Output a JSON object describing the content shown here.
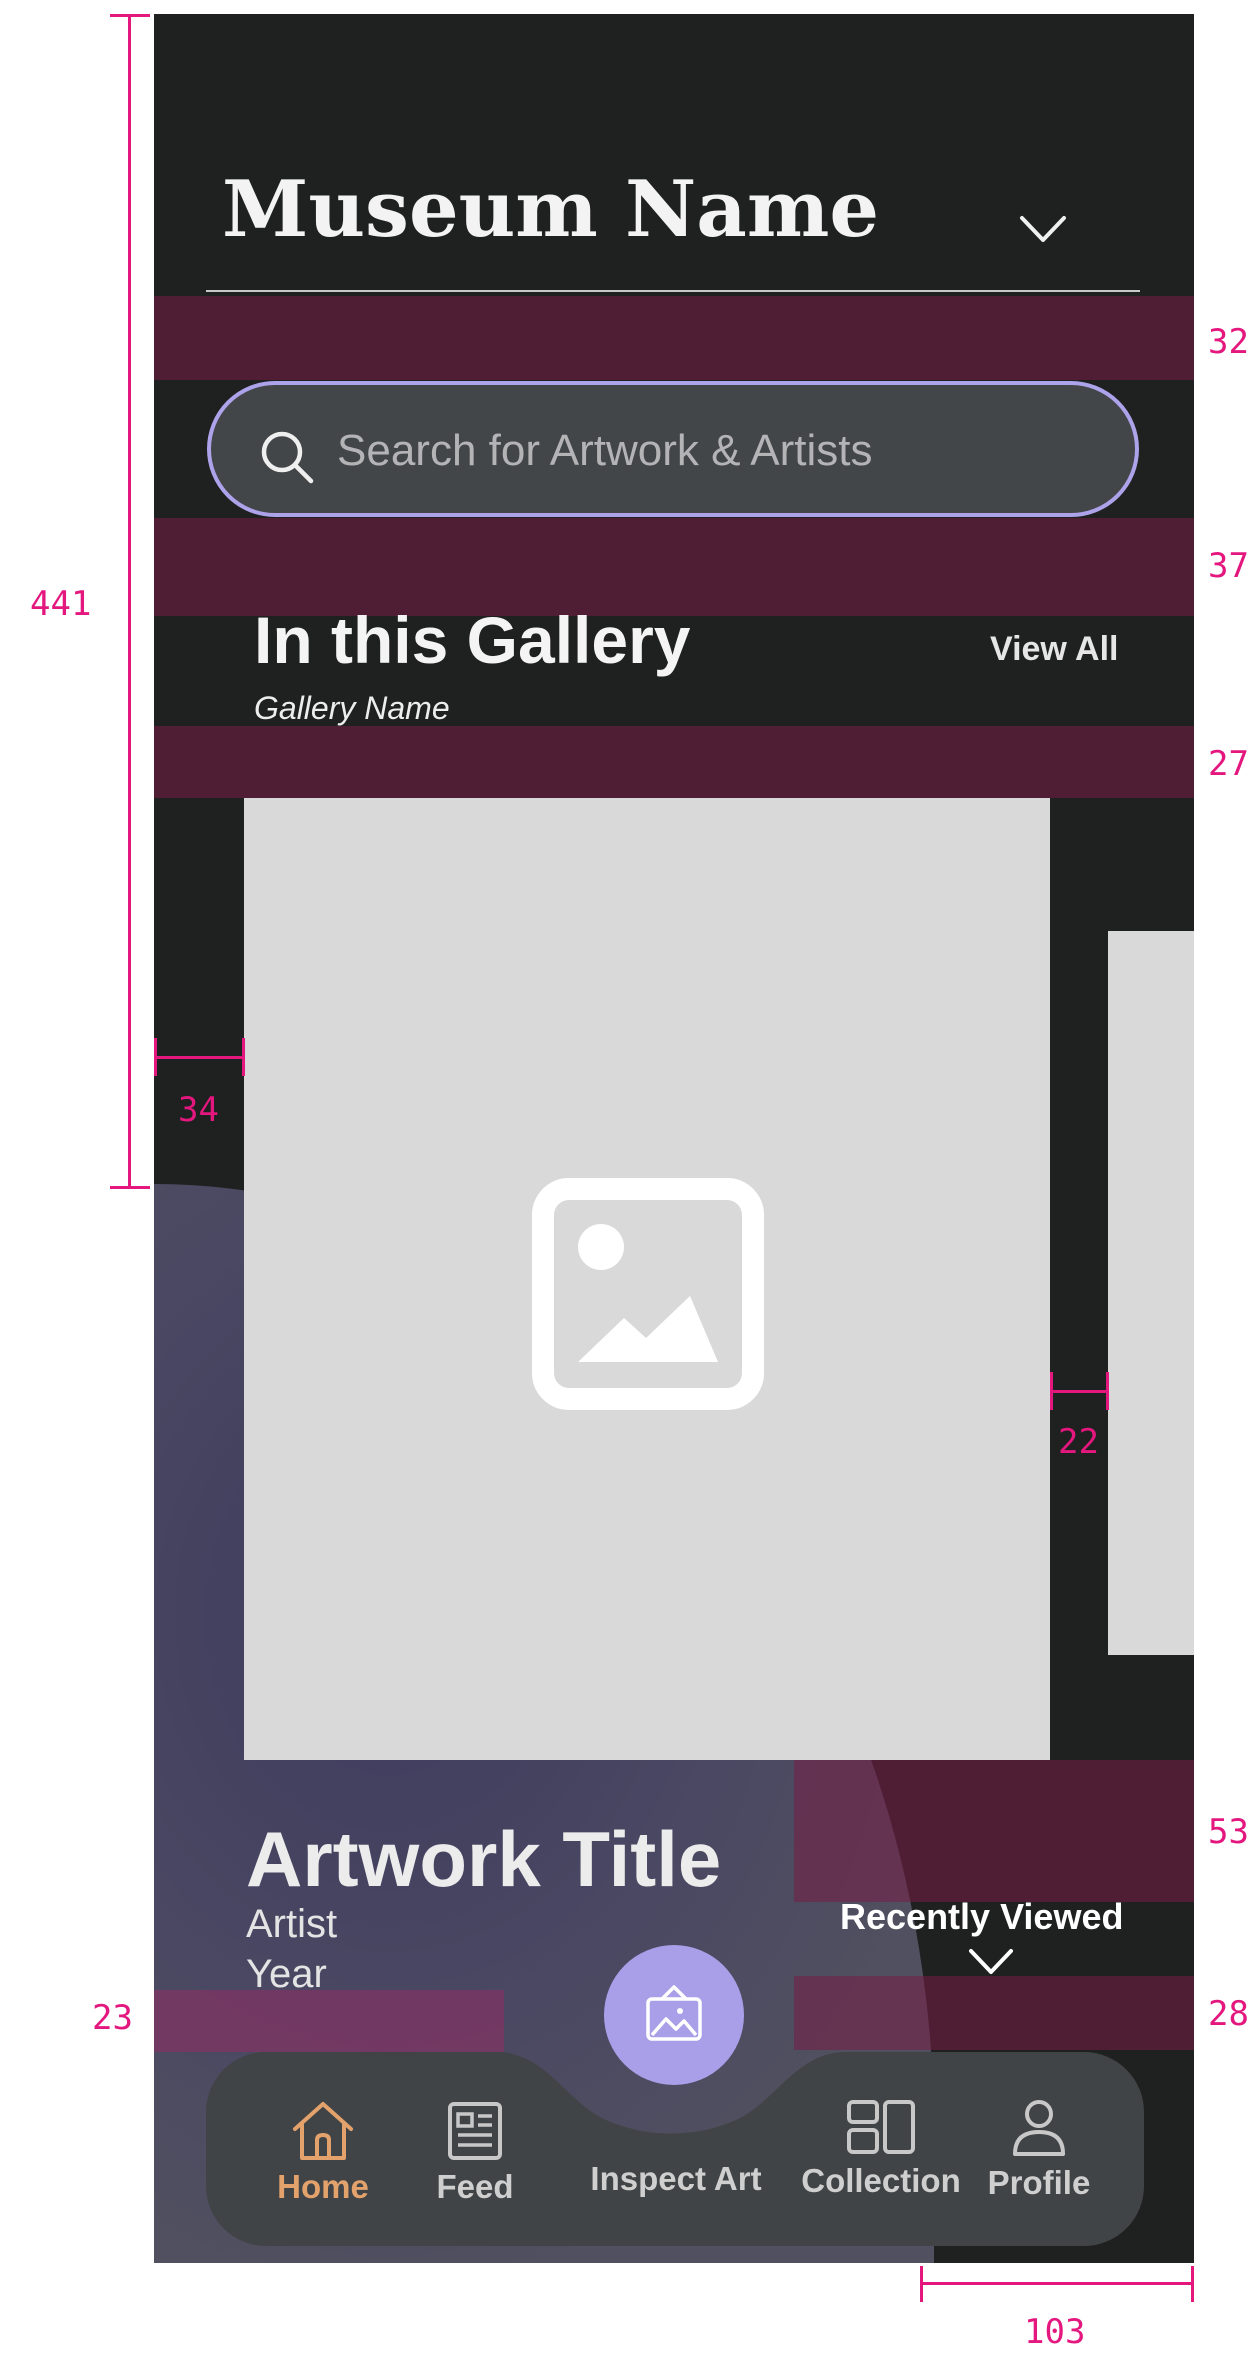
{
  "header": {
    "museum_name": "Museum Name"
  },
  "search": {
    "placeholder": "Search for Artwork & Artists",
    "value": ""
  },
  "gallery": {
    "heading": "In this Gallery",
    "view_all_label": "View All",
    "gallery_name": "Gallery Name"
  },
  "artwork": {
    "title": "Artwork Title",
    "artist": "Artist",
    "year": "Year"
  },
  "recently_viewed": {
    "label": "Recently Viewed"
  },
  "nav": {
    "home_label": "Home",
    "feed_label": "Feed",
    "inspect_label": "Inspect Art",
    "collection_label": "Collection",
    "profile_label": "Profile",
    "active": "home"
  },
  "spec_annotations": {
    "top_section_height": "441",
    "search_gap": "32",
    "gallery_gap": "37",
    "card_gap": "27",
    "card_left_margin": "34",
    "card_spacing": "22",
    "recent_top_gap": "53",
    "recent_bottom_gap": "28",
    "artist_gap": "23",
    "nav_side_width": "103"
  },
  "colors": {
    "background": "#1f2020",
    "accent": "#aca3eb",
    "active_nav": "#e3a26c",
    "annotation": "#e4177f",
    "placeholder_card": "#d9d9d9"
  },
  "icons": [
    "chevron-down-icon",
    "search-icon",
    "image-placeholder-icon",
    "home-icon",
    "feed-icon",
    "inspect-art-icon",
    "collection-icon",
    "profile-icon"
  ]
}
